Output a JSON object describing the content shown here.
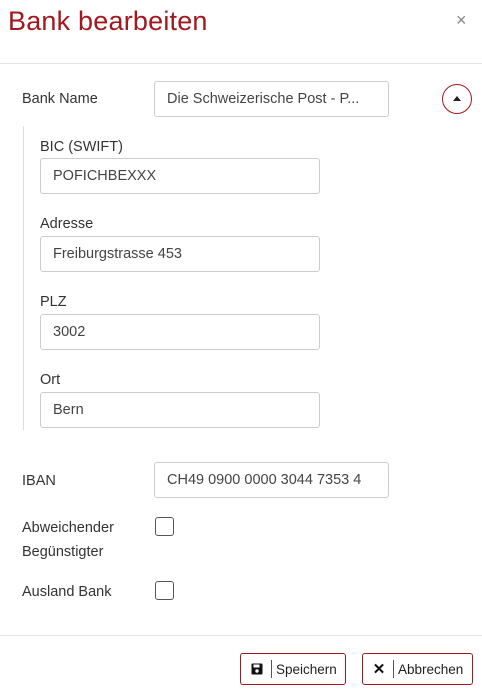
{
  "dialog": {
    "title": "Bank bearbeiten",
    "close_symbol": "×"
  },
  "form": {
    "bank_name": {
      "label": "Bank Name",
      "value": "Die Schweizerische Post - P..."
    },
    "bic": {
      "label": "BIC (SWIFT)",
      "value": "POFICHBEXXX"
    },
    "adresse": {
      "label": "Adresse",
      "value": "Freiburgstrasse 453"
    },
    "plz": {
      "label": "PLZ",
      "value": "3002"
    },
    "ort": {
      "label": "Ort",
      "value": "Bern"
    },
    "iban": {
      "label": "IBAN",
      "value": "CH49 0900 0000 3044 7353 4"
    },
    "abweichender": {
      "label_line1": "Abweichender",
      "label_line2": "Begünstigter",
      "checked": false
    },
    "ausland": {
      "label": "Ausland Bank",
      "checked": false
    }
  },
  "footer": {
    "save_label": "Speichern",
    "cancel_label": "Abbrechen"
  },
  "icons": {
    "close": "close-icon",
    "collapse": "caret-up-icon",
    "save": "floppy-disk-icon",
    "cancel": "x-icon"
  },
  "colors": {
    "accent": "#a3171f",
    "border": "#cccccc"
  }
}
